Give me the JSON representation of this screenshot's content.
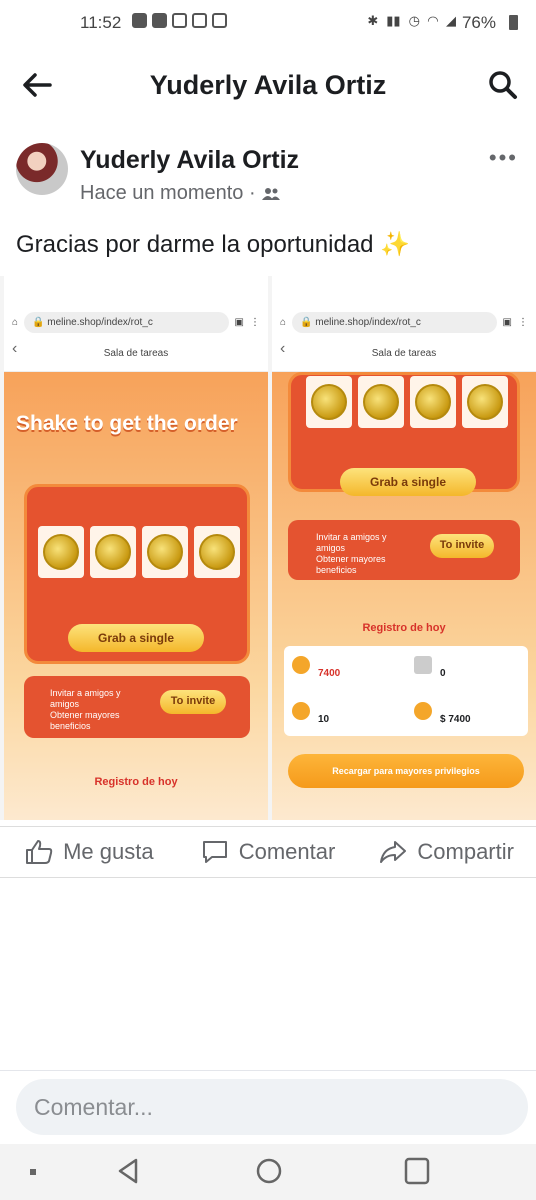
{
  "status_bar": {
    "time": "11:52",
    "battery": "76%"
  },
  "app_bar": {
    "title": "Yuderly Avila Ortiz"
  },
  "post": {
    "author": "Yuderly Avila Ortiz",
    "timestamp": "Hace un momento ·",
    "text": "Gracias por darme la oportunidad ✨"
  },
  "screenshot_left": {
    "url": "meline.shop/index/rot_c",
    "page_title": "Sala de tareas",
    "banner": "Shake to get the order",
    "grab_button": "Grab a single",
    "invite_text": "Invitar a amigos y amigos\nObtener mayores beneficios",
    "invite_button": "To invite",
    "registro": "Registro de hoy"
  },
  "screenshot_right": {
    "url": "meline.shop/index/rot_c",
    "page_title": "Sala de tareas",
    "grab_button": "Grab a single",
    "invite_text": "Invitar a amigos y amigos\nObtener mayores beneficios",
    "invite_button": "To invite",
    "registro": "Registro de hoy",
    "stats": [
      {
        "value": "7400"
      },
      {
        "value": "0"
      },
      {
        "value": "10"
      },
      {
        "value": "$ 7400"
      }
    ],
    "recharge_button": "Recargar para mayores privilegios"
  },
  "actions": {
    "like": "Me gusta",
    "comment": "Comentar",
    "share": "Compartir"
  },
  "comment_box": {
    "placeholder": "Comentar..."
  },
  "colors": {
    "accent_orange": "#f59a1a",
    "machine_red": "#e5532f",
    "fb_gray": "#65676b"
  }
}
